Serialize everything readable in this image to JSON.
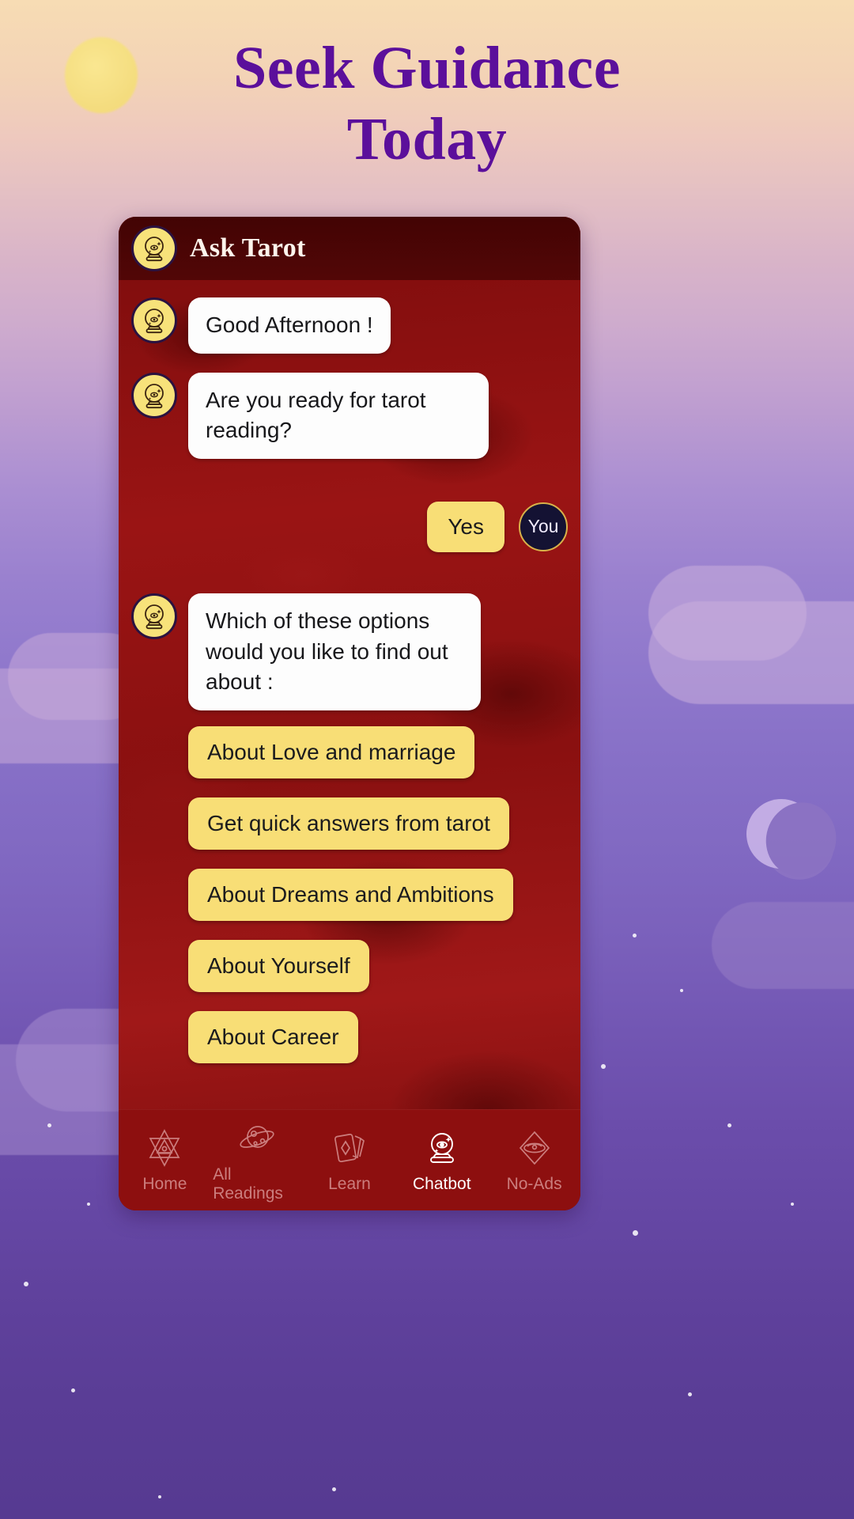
{
  "headline": {
    "line1": "Seek Guidance",
    "line2": "Today"
  },
  "colors": {
    "headline": "#5b0f9b",
    "chat_background": "#8d1111",
    "accent_yellow": "#f8de76",
    "bubble_white": "#fdfdfd",
    "nav_background": "#8d0f0f",
    "you_badge": "#141233",
    "you_badge_border": "#d8b24a"
  },
  "chat": {
    "header": {
      "title": "Ask Tarot",
      "avatar_icon": "crystal-ball-icon"
    },
    "messages": [
      {
        "sender": "bot",
        "text": "Good Afternoon !"
      },
      {
        "sender": "bot",
        "text": "Are you ready for tarot reading?"
      }
    ],
    "user_reply": {
      "answer": "Yes",
      "badge": "You"
    },
    "prompt": "Which of these options would you like to find out about :",
    "options": [
      "About Love and marriage",
      "Get quick answers from tarot",
      "About Dreams and Ambitions",
      "About Yourself",
      "About Career"
    ]
  },
  "bottom_nav": {
    "items": [
      {
        "label": "Home",
        "icon": "hexagram-eye-icon",
        "active": false
      },
      {
        "label": "All Readings",
        "icon": "planet-icon",
        "active": false
      },
      {
        "label": "Learn",
        "icon": "tarot-cards-icon",
        "active": false
      },
      {
        "label": "Chatbot",
        "icon": "crystal-ball-icon",
        "active": true
      },
      {
        "label": "No-Ads",
        "icon": "diamond-eye-icon",
        "active": false
      }
    ]
  }
}
